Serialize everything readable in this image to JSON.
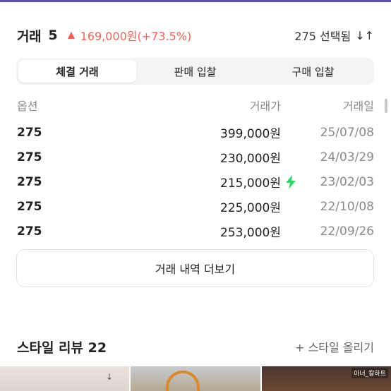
{
  "colors": {
    "accent_up": "#ef6253",
    "bolt": "#2fd36a",
    "top_strip": "#5b4fa8"
  },
  "header": {
    "title": "거래",
    "count": "5",
    "trend_icon": "triangle-up-icon",
    "change": "169,000원(+73.5%)",
    "selected_size": "275 선택됨",
    "sort_icon": "sort-arrows-icon"
  },
  "tabs": [
    {
      "label": "체결 거래",
      "active": true
    },
    {
      "label": "판매 입찰",
      "active": false
    },
    {
      "label": "구매 입찰",
      "active": false
    }
  ],
  "table": {
    "columns": [
      "옵션",
      "거래가",
      "거래일"
    ],
    "rows": [
      {
        "option": "275",
        "price": "399,000원",
        "date": "25/07/08",
        "fast": false
      },
      {
        "option": "275",
        "price": "230,000원",
        "date": "24/03/29",
        "fast": false
      },
      {
        "option": "275",
        "price": "215,000원",
        "date": "23/02/03",
        "fast": true
      },
      {
        "option": "275",
        "price": "225,000원",
        "date": "22/10/08",
        "fast": false
      },
      {
        "option": "275",
        "price": "253,000원",
        "date": "22/09/26",
        "fast": false
      }
    ]
  },
  "more_button": "거래 내역 더보기",
  "reviews": {
    "title": "스타일 리뷰 22",
    "add_label": "+ 스타일 올리기",
    "thumb_tag": "아너_칼하트"
  }
}
